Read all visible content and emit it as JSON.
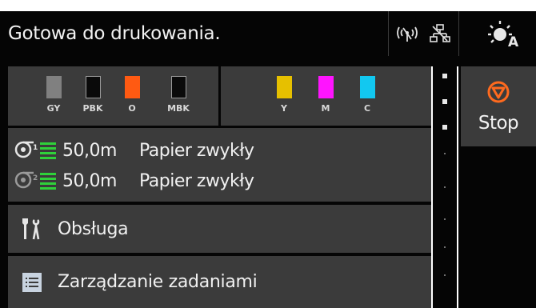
{
  "status": {
    "text": "Gotowa do drukowania.",
    "icons": [
      "wireless-off-icon",
      "wired-network-off-icon",
      "display-brightness-auto-icon"
    ]
  },
  "inks_left": [
    {
      "label": "GY",
      "color": "#808080"
    },
    {
      "label": "PBK",
      "color": "#0a0a0a"
    },
    {
      "label": "O",
      "color": "#ff5a12"
    },
    {
      "label": "MBK",
      "color": "#0a0a0a"
    }
  ],
  "inks_right": [
    {
      "label": "Y",
      "color": "#e6c000"
    },
    {
      "label": "M",
      "color": "#ff14ff"
    },
    {
      "label": "C",
      "color": "#12c8f0"
    }
  ],
  "paper": [
    {
      "roll": "1",
      "length": "50,0m",
      "type": "Papier zwykły"
    },
    {
      "roll": "2",
      "length": "50,0m",
      "type": "Papier zwykły"
    }
  ],
  "menu": {
    "maintenance": "Obsługa",
    "jobs": "Zarządzanie zadaniami"
  },
  "stop": {
    "label": "Stop"
  },
  "colors": {
    "accent_orange": "#ff6a1e",
    "panel": "#3b3b3b",
    "background": "#050505",
    "ink_level_green": "#2fd13a"
  }
}
